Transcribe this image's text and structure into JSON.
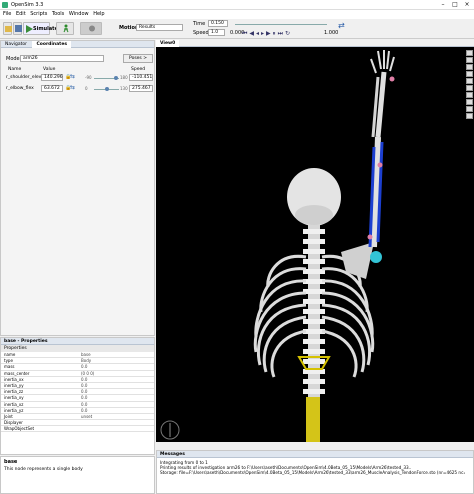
{
  "window": {
    "title": "OpenSim 3.3"
  },
  "menu": [
    "File",
    "Edit",
    "Scripts",
    "Tools",
    "Window",
    "Help"
  ],
  "toolbar": {
    "simulate_label": "Simulate",
    "motion_label": "Motion:",
    "motion_value": "Results",
    "time_label": "Time",
    "time_value": "0.150",
    "speed_label": "Speed",
    "speed_value": "1.0",
    "time_display": "0.000",
    "speed_max": "1.000"
  },
  "navigator": {
    "tabs": [
      "Navigator",
      "Coordinates"
    ],
    "model_label": "Model:",
    "model_value": "arm26",
    "poses_button": "Poses >",
    "columns": [
      "Name",
      "Value",
      "Speed"
    ],
    "coords": [
      {
        "name": "r_shoulder_elev",
        "value": "140.296",
        "range_min": "-90",
        "range_max": "180",
        "speed": "-110.451",
        "fraction": 0.85
      },
      {
        "name": "r_elbow_flex",
        "value": "63.672",
        "range_min": "0",
        "range_max": "130",
        "speed": "275.467",
        "fraction": 0.49
      }
    ]
  },
  "properties": {
    "title": "base - Properties",
    "section": "Properties",
    "rows": [
      {
        "k": "name",
        "v": "base"
      },
      {
        "k": "type",
        "v": "Body"
      },
      {
        "k": "mass",
        "v": "0.0"
      },
      {
        "k": "mass_center",
        "v": "(0 0 0)"
      },
      {
        "k": "inertia_xx",
        "v": "0.0"
      },
      {
        "k": "inertia_yy",
        "v": "0.0"
      },
      {
        "k": "inertia_zz",
        "v": "0.0"
      },
      {
        "k": "inertia_xy",
        "v": "0.0"
      },
      {
        "k": "inertia_xz",
        "v": "0.0"
      },
      {
        "k": "inertia_yz",
        "v": "0.0"
      },
      {
        "k": "Joint",
        "v": "unset"
      },
      {
        "k": "Displayer",
        "v": ""
      },
      {
        "k": "WrapObjectSet",
        "v": ""
      }
    ]
  },
  "info": {
    "title": "base",
    "text": "This node represents a single body"
  },
  "viewer": {
    "tab": "View0"
  },
  "messages": {
    "title": "Messages",
    "lines": [
      "Integrating from 0 to 1",
      "Printing results of investigation arm26 to F:\\Users\\aseth\\Documents\\OpenSim\\4.0Beta_05_15\\Models\\Arm26\\tested_33..",
      "Storage: file=F:\\Users\\aseth\\Documents\\OpenSim\\4.0Beta_05_15\\Models\\Arm26\\tested_33\\arm26_MuscleAnalysis_TendonForce.sto (nr=4625 nc=7)"
    ]
  }
}
